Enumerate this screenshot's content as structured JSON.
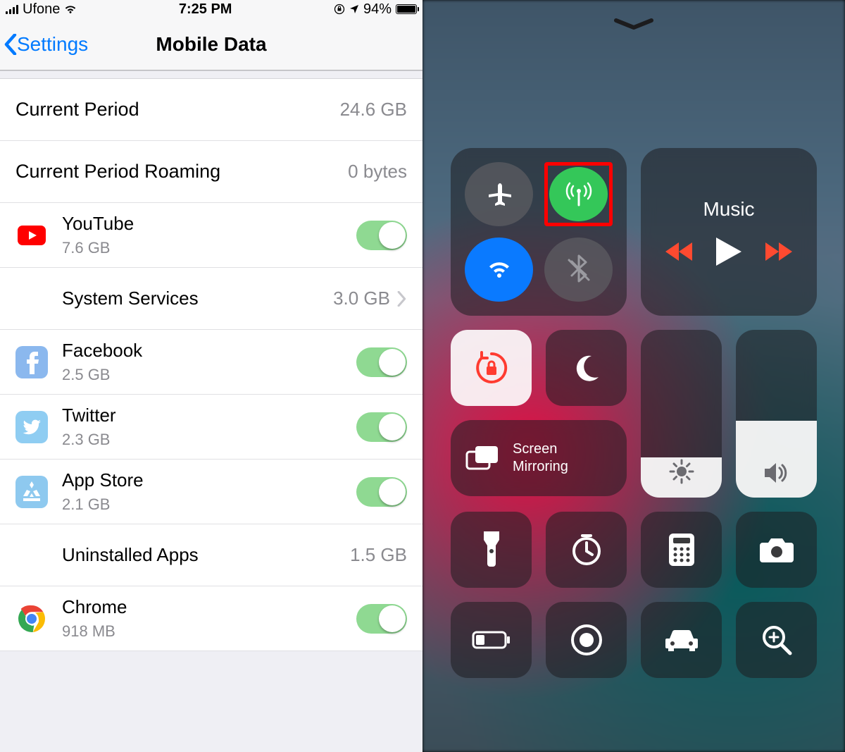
{
  "statusbar": {
    "carrier": "Ufone",
    "time": "7:25 PM",
    "battery_pct": "94%"
  },
  "nav": {
    "back_label": "Settings",
    "title": "Mobile Data"
  },
  "usage": {
    "current_period_label": "Current Period",
    "current_period_value": "24.6 GB",
    "roaming_label": "Current Period Roaming",
    "roaming_value": "0 bytes"
  },
  "apps": [
    {
      "name": "YouTube",
      "data": "7.6 GB",
      "toggle": true,
      "icon": "youtube",
      "has_sub": true
    },
    {
      "name": "System Services",
      "data": "3.0 GB",
      "toggle": false,
      "disclosure": true,
      "has_sub": false
    },
    {
      "name": "Facebook",
      "data": "2.5 GB",
      "toggle": true,
      "icon": "facebook",
      "has_sub": true
    },
    {
      "name": "Twitter",
      "data": "2.3 GB",
      "toggle": true,
      "icon": "twitter",
      "has_sub": true
    },
    {
      "name": "App Store",
      "data": "2.1 GB",
      "toggle": true,
      "icon": "appstore",
      "has_sub": true
    },
    {
      "name": "Uninstalled Apps",
      "data": "1.5 GB",
      "toggle": false,
      "has_sub": false
    },
    {
      "name": "Chrome",
      "data": "918 MB",
      "toggle": true,
      "icon": "chrome",
      "has_sub": true
    }
  ],
  "control_center": {
    "music_label": "Music",
    "screen_mirroring_label": "Screen\nMirroring",
    "brightness_pct": 24,
    "volume_pct": 46,
    "cellular_highlighted": true
  }
}
